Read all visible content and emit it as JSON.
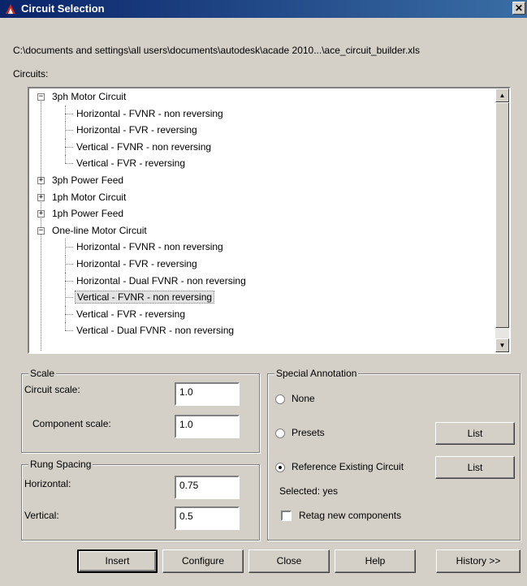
{
  "window": {
    "title": "Circuit Selection",
    "close_glyph": "✕"
  },
  "file_path": "C:\\documents and settings\\all users\\documents\\autodesk\\acade 2010...\\ace_circuit_builder.xls",
  "circuits_label": "Circuits:",
  "tree": [
    {
      "label": "3ph Motor Circuit",
      "level": 0,
      "expander": "−"
    },
    {
      "label": "Horizontal - FVNR - non reversing",
      "level": 1
    },
    {
      "label": "Horizontal - FVR - reversing",
      "level": 1
    },
    {
      "label": "Vertical - FVNR - non reversing",
      "level": 1
    },
    {
      "label": "Vertical - FVR - reversing",
      "level": 1
    },
    {
      "label": "3ph Power Feed",
      "level": 0,
      "expander": "+"
    },
    {
      "label": "1ph Motor Circuit",
      "level": 0,
      "expander": "+"
    },
    {
      "label": "1ph Power Feed",
      "level": 0,
      "expander": "+"
    },
    {
      "label": "One-line Motor Circuit",
      "level": 0,
      "expander": "−"
    },
    {
      "label": "Horizontal - FVNR - non reversing",
      "level": 1
    },
    {
      "label": "Horizontal - FVR - reversing",
      "level": 1
    },
    {
      "label": "Horizontal - Dual FVNR - non reversing",
      "level": 1
    },
    {
      "label": "Vertical - FVNR - non reversing",
      "level": 1,
      "selected": true
    },
    {
      "label": "Vertical - FVR - reversing",
      "level": 1
    },
    {
      "label": "Vertical - Dual FVNR - non reversing",
      "level": 1
    }
  ],
  "scrollbar": {
    "up_glyph": "▲",
    "down_glyph": "▼"
  },
  "scale": {
    "title": "Scale",
    "circuit_label": "Circuit scale:",
    "circuit_value": "1.0",
    "component_label": "Component scale:",
    "component_value": "1.0"
  },
  "rung": {
    "title": "Rung Spacing",
    "horizontal_label": "Horizontal:",
    "horizontal_value": "0.75",
    "vertical_label": "Vertical:",
    "vertical_value": "0.5"
  },
  "annotation": {
    "title": "Special Annotation",
    "none_label": "None",
    "presets_label": "Presets",
    "reference_label": "Reference Existing Circuit",
    "list_label": "List",
    "selected_text": "Selected: yes",
    "retag_label": "Retag new components",
    "selected_option": "reference"
  },
  "buttons": {
    "insert": "Insert",
    "configure": "Configure",
    "close": "Close",
    "help": "Help",
    "history": "History >>"
  }
}
